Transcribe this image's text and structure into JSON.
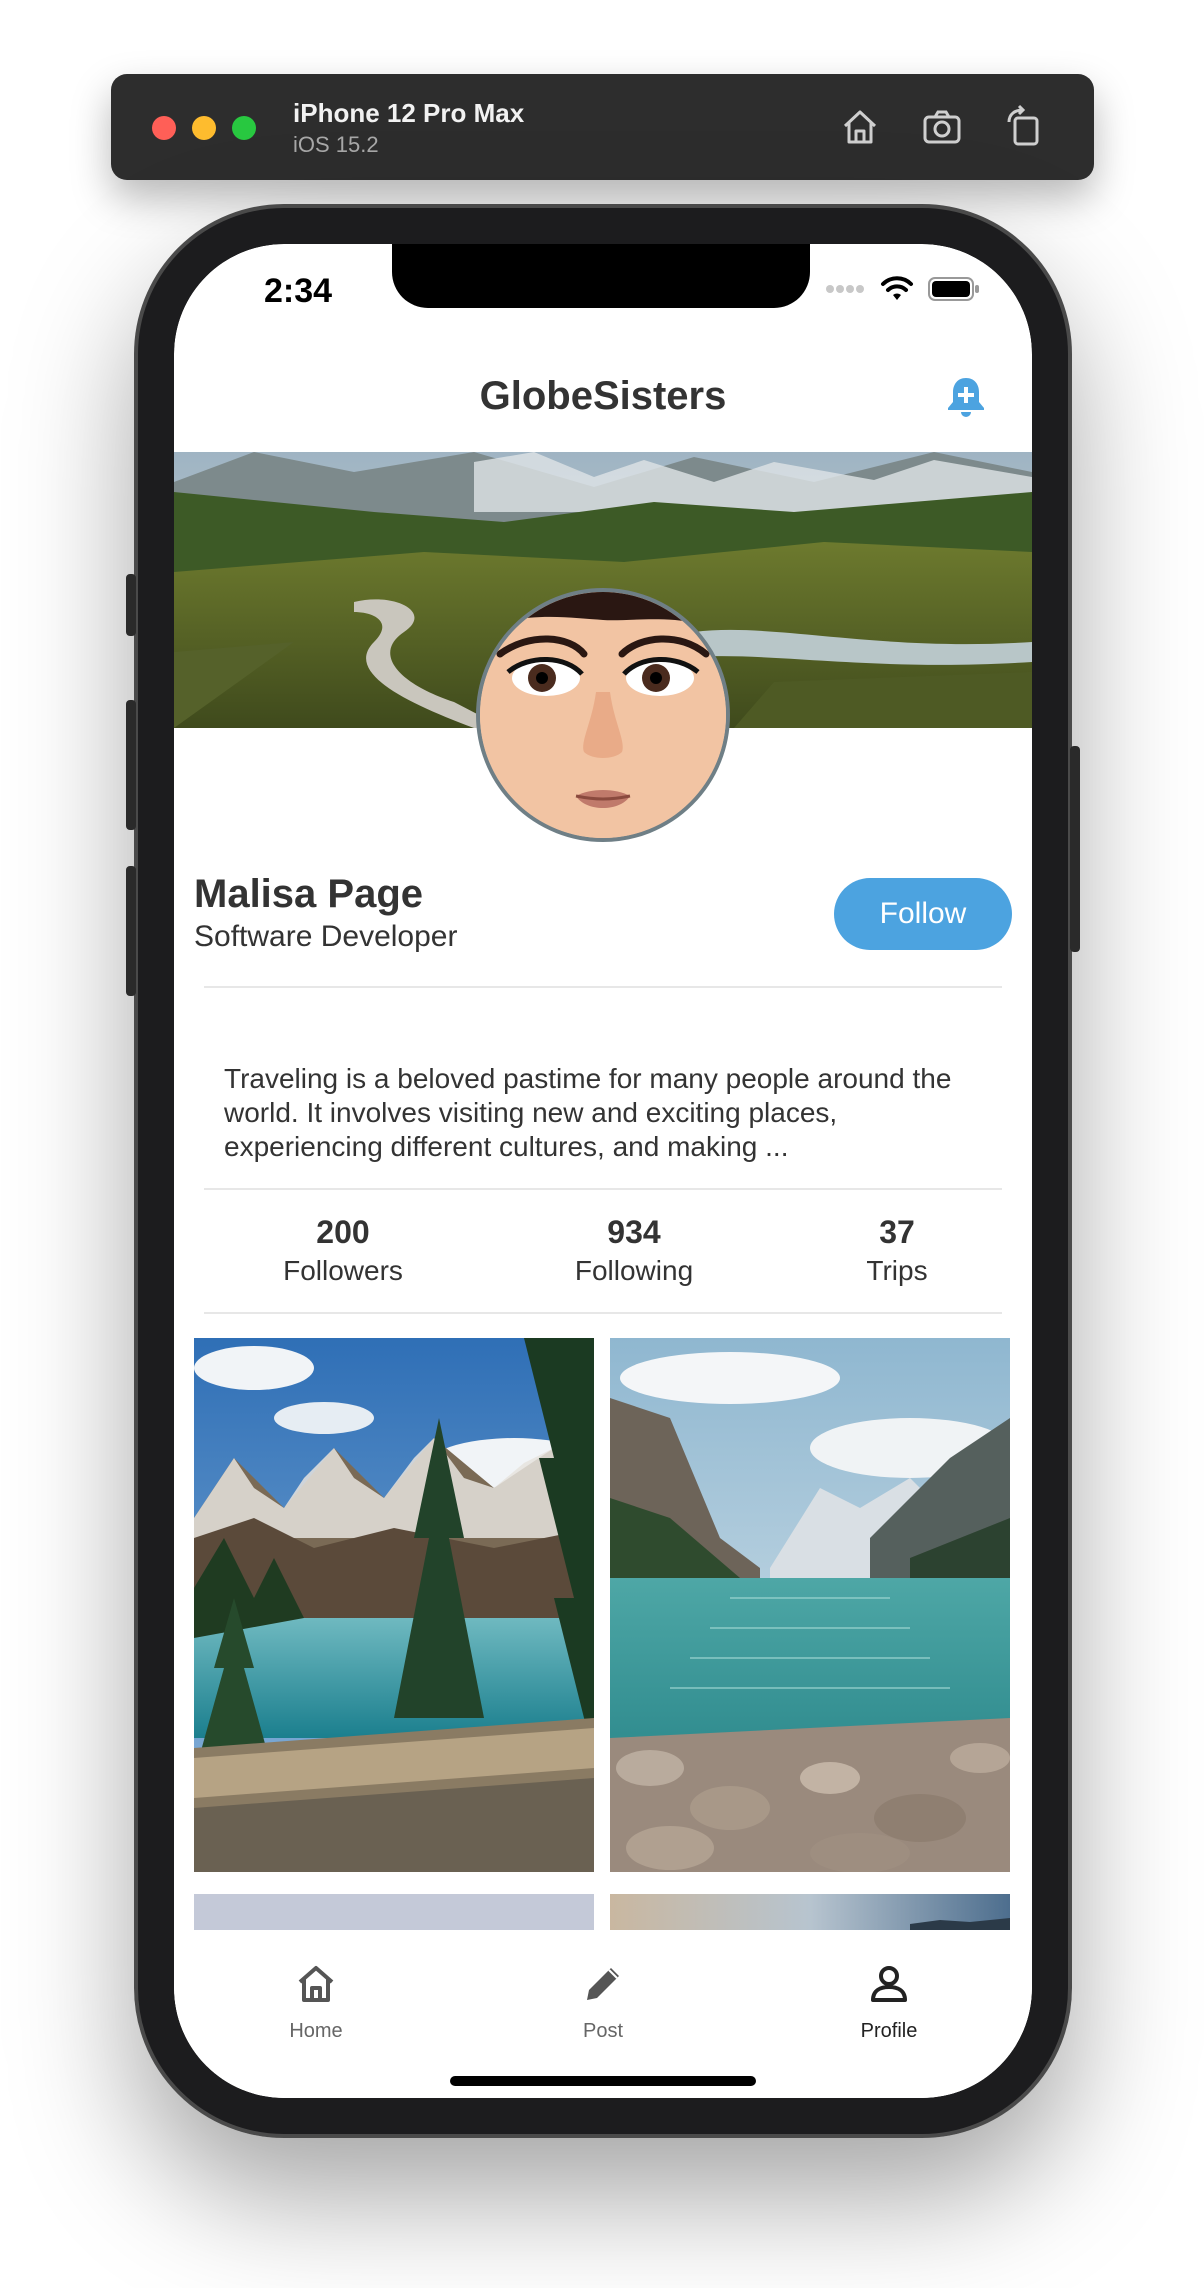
{
  "simulator": {
    "device_name": "iPhone 12 Pro Max",
    "os_version": "iOS 15.2",
    "toolbar_icons": [
      "home-icon",
      "screenshot-icon",
      "rotate-icon"
    ]
  },
  "status_bar": {
    "time": "2:34"
  },
  "app_bar": {
    "title": "GlobeSisters",
    "action_icon": "add-notification-icon"
  },
  "profile": {
    "name": "Malisa Page",
    "role": "Software Developer",
    "follow_label": "Follow",
    "bio": "Traveling is a beloved pastime for many people around the world. It involves visiting new and exciting places, experiencing different cultures, and making ..."
  },
  "stats": [
    {
      "value": "200",
      "label": "Followers"
    },
    {
      "value": "934",
      "label": "Following"
    },
    {
      "value": "37",
      "label": "Trips"
    }
  ],
  "bottom_nav": {
    "items": [
      {
        "label": "Home",
        "icon": "home-icon",
        "active": false
      },
      {
        "label": "Post",
        "icon": "edit-icon",
        "active": false
      },
      {
        "label": "Profile",
        "icon": "person-icon",
        "active": true
      }
    ]
  },
  "colors": {
    "accent": "#4ca3e0",
    "text_primary": "#333333",
    "nav_inactive": "#666666",
    "nav_active": "#222222"
  }
}
